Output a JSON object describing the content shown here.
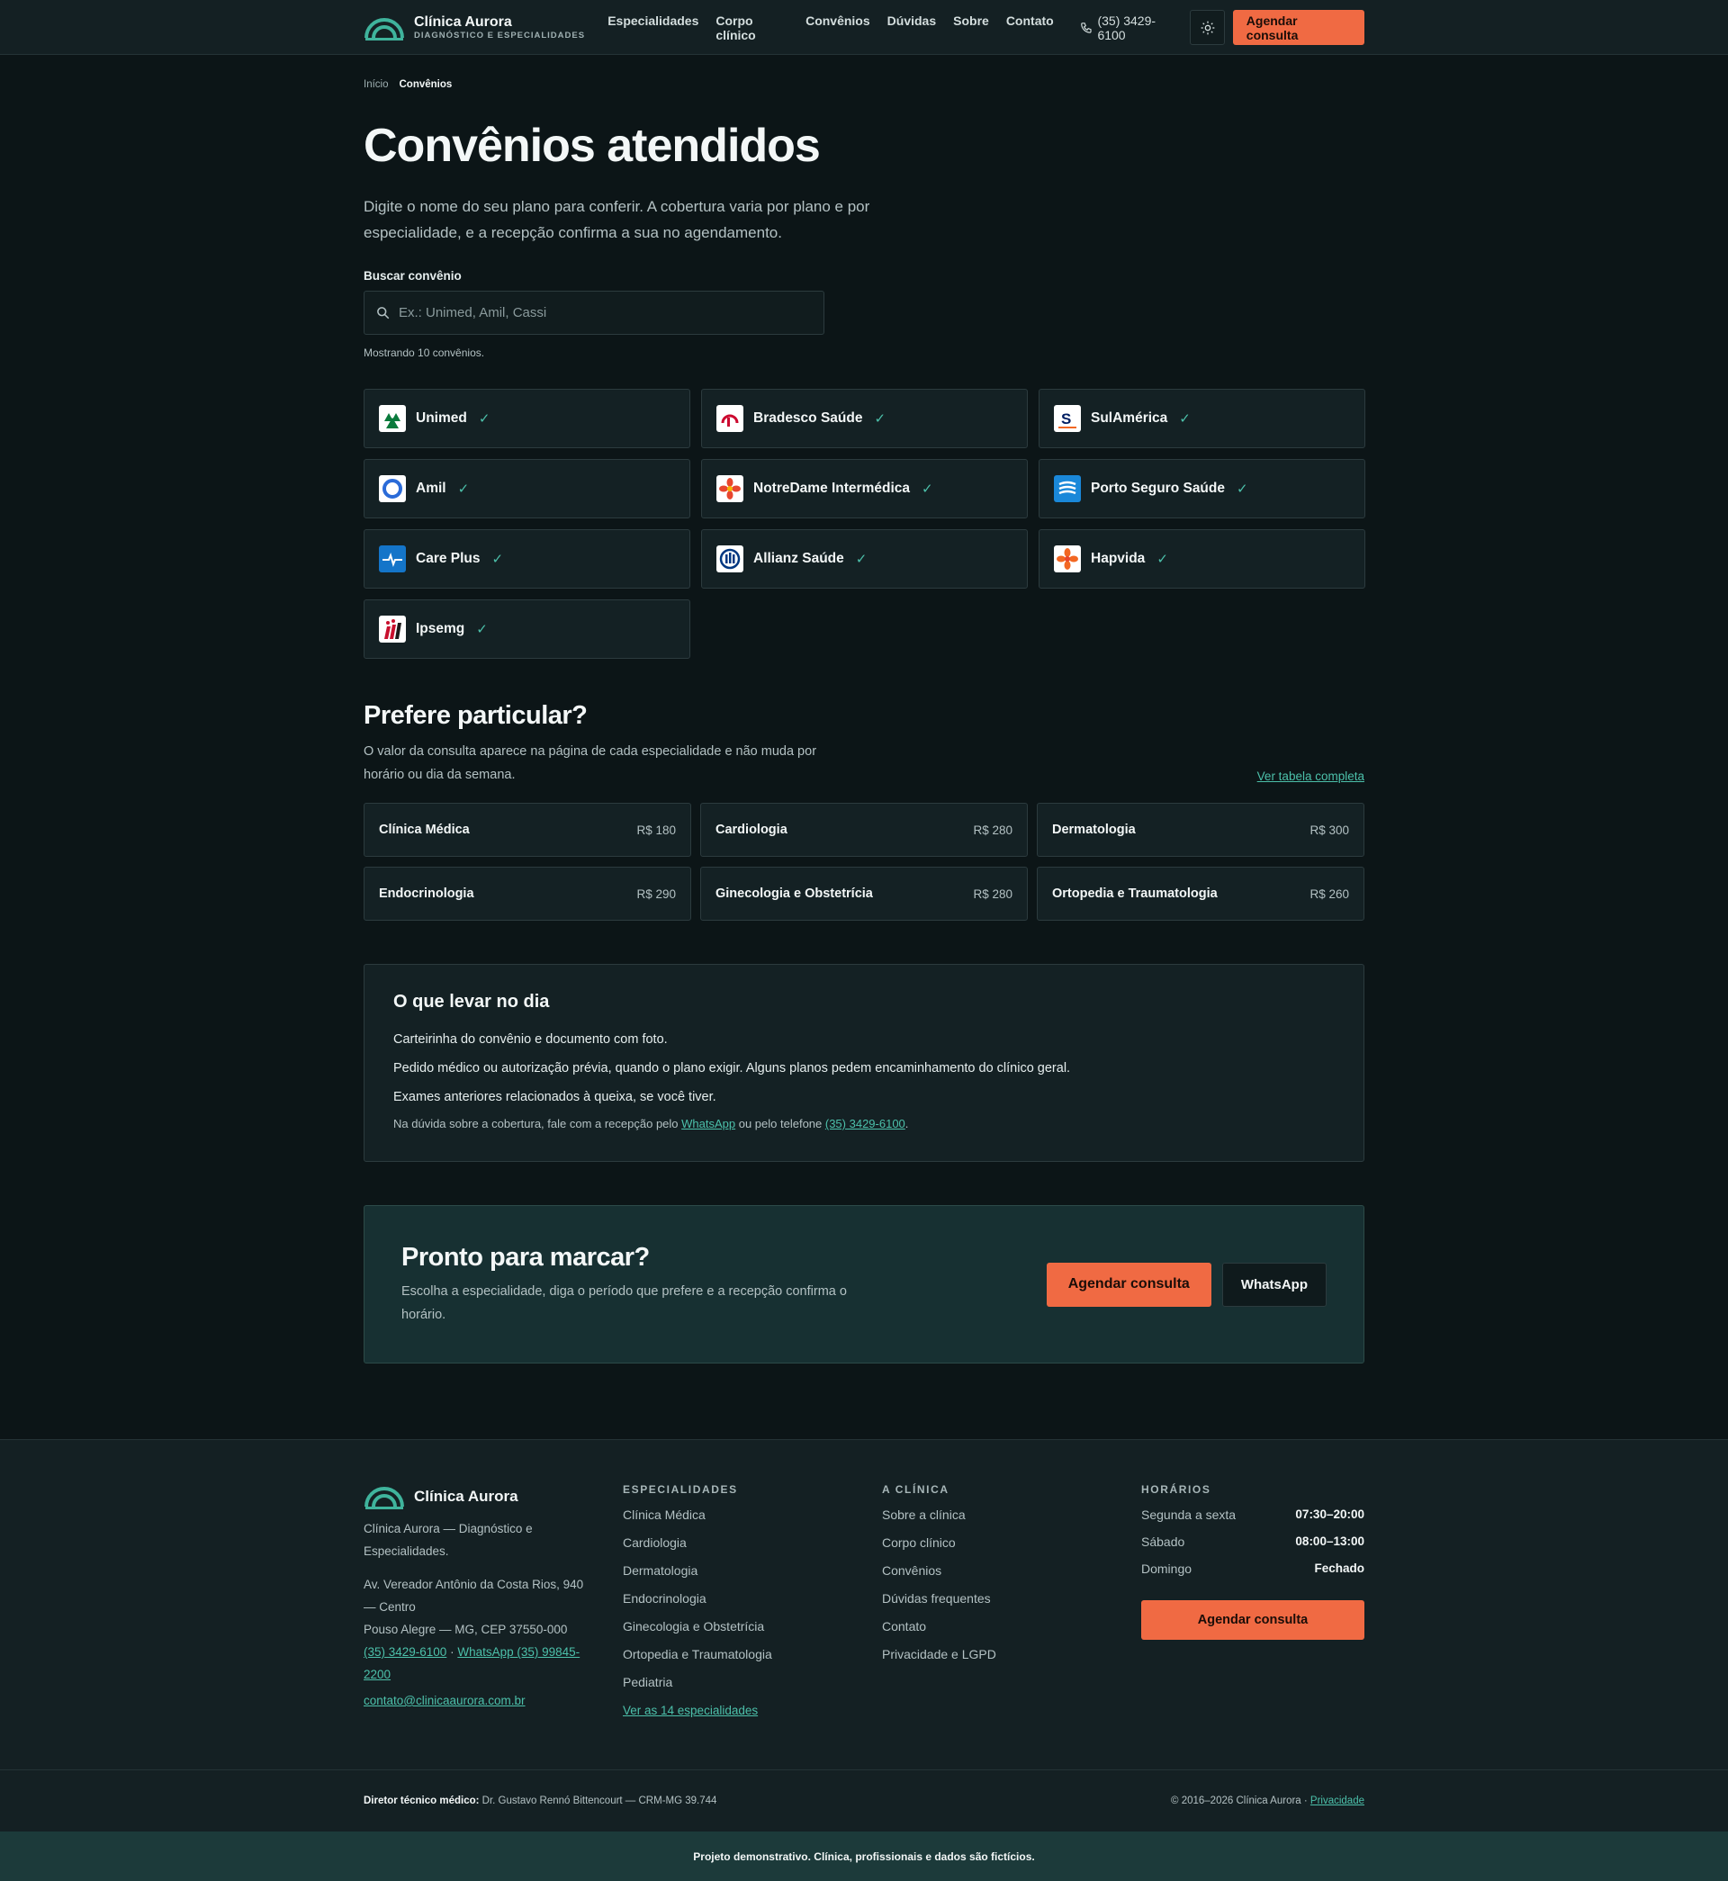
{
  "header": {
    "brand_name": "Clínica Aurora",
    "brand_tag": "DIAGNÓSTICO E ESPECIALIDADES",
    "nav": [
      "Especialidades",
      "Corpo clínico",
      "Convênios",
      "Dúvidas",
      "Sobre",
      "Contato"
    ],
    "phone": "(35) 3429-6100",
    "cta": "Agendar consulta"
  },
  "breadcrumb": {
    "home": "Início",
    "current": "Convênios"
  },
  "hero": {
    "title": "Convênios atendidos",
    "lead": "Digite o nome do seu plano para conferir. A cobertura varia por plano e por especialidade, e a recepção confirma a sua no agendamento."
  },
  "search": {
    "label": "Buscar convênio",
    "placeholder": "Ex.: Unimed, Amil, Cassi",
    "value": "",
    "count": "Mostrando 10 convênios."
  },
  "plans": [
    {
      "name": "Unimed",
      "icon": "unimed-logo-icon",
      "color": "#0a7a3c"
    },
    {
      "name": "Bradesco Saúde",
      "icon": "bradesco-logo-icon",
      "color": "#cc092f"
    },
    {
      "name": "SulAmérica",
      "icon": "sulamerica-logo-icon",
      "color": "#001e62"
    },
    {
      "name": "Amil",
      "icon": "amil-logo-icon",
      "color": "#2b6bd8"
    },
    {
      "name": "NotreDame Intermédica",
      "icon": "notredame-logo-icon",
      "color": "#e8462e"
    },
    {
      "name": "Porto Seguro Saúde",
      "icon": "porto-logo-icon",
      "color": "#1a88d9"
    },
    {
      "name": "Care Plus",
      "icon": "careplus-logo-icon",
      "color": "#1475c9"
    },
    {
      "name": "Allianz Saúde",
      "icon": "allianz-logo-icon",
      "color": "#003781"
    },
    {
      "name": "Hapvida",
      "icon": "hapvida-logo-icon",
      "color": "#f26722"
    },
    {
      "name": "Ipsemg",
      "icon": "ipsemg-logo-icon",
      "color": "#c8102e"
    }
  ],
  "particular": {
    "title": "Prefere particular?",
    "desc": "O valor da consulta aparece na página de cada especialidade e não muda por horário ou dia da semana.",
    "link": "Ver tabela completa",
    "prices": [
      {
        "name": "Clínica Médica",
        "value": "R$ 180"
      },
      {
        "name": "Cardiologia",
        "value": "R$ 280"
      },
      {
        "name": "Dermatologia",
        "value": "R$ 300"
      },
      {
        "name": "Endocrinologia",
        "value": "R$ 290"
      },
      {
        "name": "Ginecologia e Obstetrícia",
        "value": "R$ 280"
      },
      {
        "name": "Ortopedia e Traumatologia",
        "value": "R$ 260"
      }
    ]
  },
  "bring": {
    "title": "O que levar no dia",
    "items": [
      "Carteirinha do convênio e documento com foto.",
      "Pedido médico ou autorização prévia, quando o plano exigir. Alguns planos pedem encaminhamento do clínico geral.",
      "Exames anteriores relacionados à queixa, se você tiver."
    ],
    "note_a": "Na dúvida sobre a cobertura, fale com a recepção pelo ",
    "note_link1": "WhatsApp",
    "note_b": " ou pelo telefone ",
    "note_link2": "(35) 3429-6100",
    "note_c": "."
  },
  "cta_box": {
    "title": "Pronto para marcar?",
    "text": "Escolha a especialidade, diga o período que prefere e a recepção confirma o horário.",
    "primary": "Agendar consulta",
    "secondary": "WhatsApp"
  },
  "footer": {
    "brand": "Clínica Aurora",
    "desc": "Clínica Aurora — Diagnóstico e Especialidades.",
    "address1": "Av. Vereador Antônio da Costa Rios, 940 — Centro",
    "address2": "Pouso Alegre — MG, CEP 37550-000",
    "phone": "(35) 3429-6100",
    "sep": " · ",
    "whatsapp": "WhatsApp (35) 99845-2200",
    "email": "contato@clinicaaurora.com.br",
    "spec_title": "ESPECIALIDADES",
    "specs": [
      "Clínica Médica",
      "Cardiologia",
      "Dermatologia",
      "Endocrinologia",
      "Ginecologia e Obstetrícia",
      "Ortopedia e Traumatologia",
      "Pediatria"
    ],
    "spec_link": "Ver as 14 especialidades",
    "clinic_title": "A CLÍNICA",
    "clinic": [
      "Sobre a clínica",
      "Corpo clínico",
      "Convênios",
      "Dúvidas frequentes",
      "Contato",
      "Privacidade e LGPD"
    ],
    "hours_title": "HORÁRIOS",
    "hours": [
      {
        "day": "Segunda a sexta",
        "time": "07:30–20:00"
      },
      {
        "day": "Sábado",
        "time": "08:00–13:00"
      },
      {
        "day": "Domingo",
        "time": "Fechado"
      }
    ],
    "cta": "Agendar consulta",
    "director_label": "Diretor técnico médico:",
    "director": " Dr. Gustavo Rennó Bittencourt — CRM-MG 39.744",
    "copyright": "© 2016–2026 Clínica Aurora · ",
    "privacy": "Privacidade",
    "demo": "Projeto demonstrativo. Clínica, profissionais e dados são fictícios."
  },
  "colors": {
    "accent": "#f06a43",
    "teal": "#4cc0aa",
    "bg": "#0c1517"
  }
}
